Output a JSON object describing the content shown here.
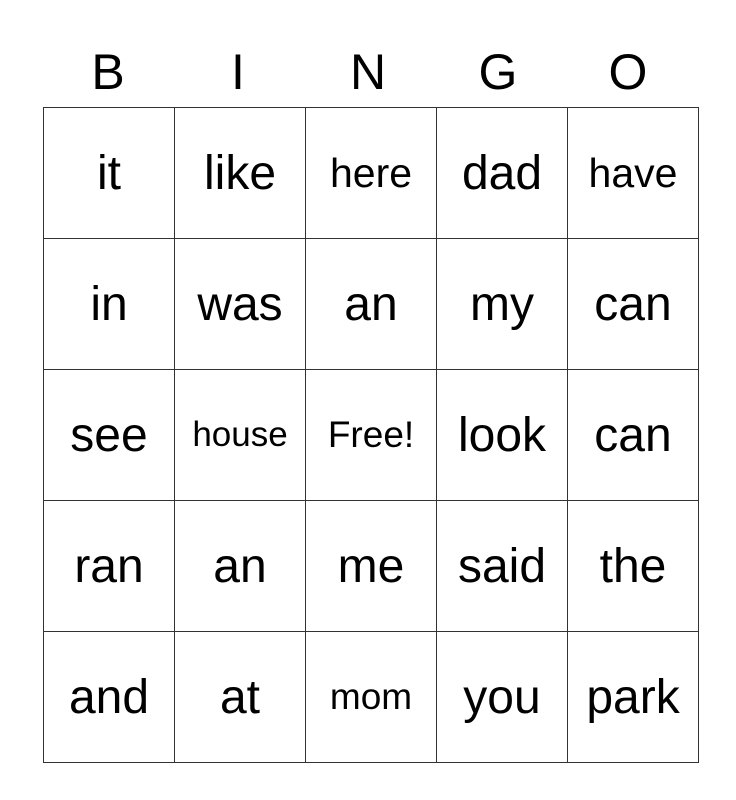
{
  "header": {
    "letters": [
      "B",
      "I",
      "N",
      "G",
      "O"
    ]
  },
  "board": {
    "rows": [
      [
        "it",
        "like",
        "here",
        "dad",
        "have"
      ],
      [
        "in",
        "was",
        "an",
        "my",
        "can"
      ],
      [
        "see",
        "house",
        "Free!",
        "look",
        "can"
      ],
      [
        "ran",
        "an",
        "me",
        "said",
        "the"
      ],
      [
        "and",
        "at",
        "mom",
        "you",
        "park"
      ]
    ]
  }
}
